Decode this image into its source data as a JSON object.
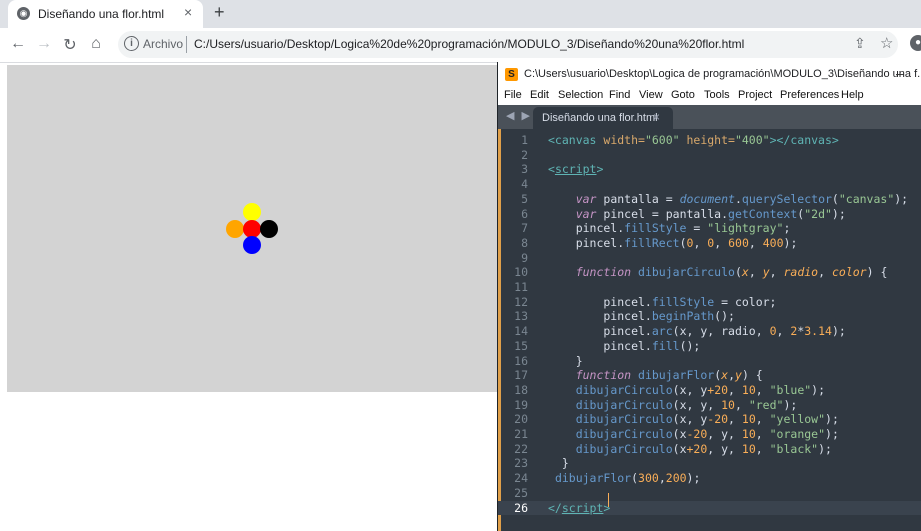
{
  "browser": {
    "tab_title": "Diseñando una flor.html",
    "tab_close": "×",
    "new_tab": "+",
    "back": "←",
    "forward": "→",
    "reload": "↻",
    "home": "⌂",
    "info": "i",
    "archivo_label": "Archivo",
    "url": "C:/Users/usuario/Desktop/Logica%20de%20programación/MODULO_3/Diseñando%20una%20flor.html",
    "share": "⇪",
    "star": "☆"
  },
  "flower": {
    "center": {
      "name": "red",
      "color": "#ff0000"
    },
    "top": {
      "name": "yellow",
      "color": "#ffff00"
    },
    "bottom": {
      "name": "blue",
      "color": "#0000ff"
    },
    "left": {
      "name": "orange",
      "color": "#ffa500"
    },
    "right": {
      "name": "black",
      "color": "#000000"
    },
    "background": "#d3d3d3"
  },
  "editor": {
    "title": "C:\\Users\\usuario\\Desktop\\Logica de programación\\MODULO_3\\Diseñando una f...",
    "minimize": "–",
    "menu": [
      "File",
      "Edit",
      "Selection",
      "Find",
      "View",
      "Goto",
      "Tools",
      "Project",
      "Preferences",
      "Help"
    ],
    "tab_arrows": "◀ ▶",
    "tab_label": "Diseñando una flor.html",
    "tab_close": "×",
    "accent": "#e0a04a",
    "background": "#303841",
    "current_line": 26,
    "lines": [
      [
        {
          "t": "<canvas ",
          "c": "tag"
        },
        {
          "t": "width=",
          "c": "attr"
        },
        {
          "t": "\"600\" ",
          "c": "str"
        },
        {
          "t": "height=",
          "c": "attr"
        },
        {
          "t": "\"400\"",
          "c": "str"
        },
        {
          "t": "></canvas>",
          "c": "tag"
        }
      ],
      [],
      [
        {
          "t": "<",
          "c": "tag"
        },
        {
          "t": "script",
          "c": "tag u"
        },
        {
          "t": ">",
          "c": "tag"
        }
      ],
      [],
      [
        {
          "t": "    "
        },
        {
          "t": "var ",
          "c": "kw"
        },
        {
          "t": "pantalla = "
        },
        {
          "t": "document",
          "c": "global"
        },
        {
          "t": "."
        },
        {
          "t": "querySelector",
          "c": "fn"
        },
        {
          "t": "("
        },
        {
          "t": "\"canvas\"",
          "c": "str"
        },
        {
          "t": ");"
        }
      ],
      [
        {
          "t": "    "
        },
        {
          "t": "var ",
          "c": "kw"
        },
        {
          "t": "pincel = pantalla."
        },
        {
          "t": "getContext",
          "c": "fn"
        },
        {
          "t": "("
        },
        {
          "t": "\"2d\"",
          "c": "str"
        },
        {
          "t": ");"
        }
      ],
      [
        {
          "t": "    pincel."
        },
        {
          "t": "fillStyle",
          "c": "fn"
        },
        {
          "t": " = "
        },
        {
          "t": "\"lightgray\"",
          "c": "str"
        },
        {
          "t": ";"
        }
      ],
      [
        {
          "t": "    pincel."
        },
        {
          "t": "fillRect",
          "c": "fn"
        },
        {
          "t": "("
        },
        {
          "t": "0",
          "c": "num"
        },
        {
          "t": ", "
        },
        {
          "t": "0",
          "c": "num"
        },
        {
          "t": ", "
        },
        {
          "t": "600",
          "c": "num"
        },
        {
          "t": ", "
        },
        {
          "t": "400",
          "c": "num"
        },
        {
          "t": ");"
        }
      ],
      [],
      [
        {
          "t": "    "
        },
        {
          "t": "function ",
          "c": "kw"
        },
        {
          "t": "dibujarCirculo",
          "c": "fnd"
        },
        {
          "t": "("
        },
        {
          "t": "x",
          "c": "param"
        },
        {
          "t": ", "
        },
        {
          "t": "y",
          "c": "param"
        },
        {
          "t": ", "
        },
        {
          "t": "radio",
          "c": "param"
        },
        {
          "t": ", "
        },
        {
          "t": "color",
          "c": "param"
        },
        {
          "t": ") {"
        }
      ],
      [],
      [
        {
          "t": "        pincel."
        },
        {
          "t": "fillStyle",
          "c": "fn"
        },
        {
          "t": " = color;"
        }
      ],
      [
        {
          "t": "        pincel."
        },
        {
          "t": "beginPath",
          "c": "fn"
        },
        {
          "t": "();"
        }
      ],
      [
        {
          "t": "        pincel."
        },
        {
          "t": "arc",
          "c": "fn"
        },
        {
          "t": "(x, y, radio, "
        },
        {
          "t": "0",
          "c": "num"
        },
        {
          "t": ", "
        },
        {
          "t": "2",
          "c": "num"
        },
        {
          "t": "*"
        },
        {
          "t": "3.14",
          "c": "num"
        },
        {
          "t": ");"
        }
      ],
      [
        {
          "t": "        pincel."
        },
        {
          "t": "fill",
          "c": "fn"
        },
        {
          "t": "();"
        }
      ],
      [
        {
          "t": "    }"
        }
      ],
      [
        {
          "t": "    "
        },
        {
          "t": "function ",
          "c": "kw"
        },
        {
          "t": "dibujarFlor",
          "c": "fnd"
        },
        {
          "t": "("
        },
        {
          "t": "x",
          "c": "param"
        },
        {
          "t": ","
        },
        {
          "t": "y",
          "c": "param"
        },
        {
          "t": ") {"
        }
      ],
      [
        {
          "t": "    "
        },
        {
          "t": "dibujarCirculo",
          "c": "fn"
        },
        {
          "t": "(x, y"
        },
        {
          "t": "+20",
          "c": "num"
        },
        {
          "t": ", "
        },
        {
          "t": "10",
          "c": "num"
        },
        {
          "t": ", "
        },
        {
          "t": "\"blue\"",
          "c": "str"
        },
        {
          "t": ");"
        }
      ],
      [
        {
          "t": "    "
        },
        {
          "t": "dibujarCirculo",
          "c": "fn"
        },
        {
          "t": "(x, y, "
        },
        {
          "t": "10",
          "c": "num"
        },
        {
          "t": ", "
        },
        {
          "t": "\"red\"",
          "c": "str"
        },
        {
          "t": ");"
        }
      ],
      [
        {
          "t": "    "
        },
        {
          "t": "dibujarCirculo",
          "c": "fn"
        },
        {
          "t": "(x, y"
        },
        {
          "t": "-20",
          "c": "num"
        },
        {
          "t": ", "
        },
        {
          "t": "10",
          "c": "num"
        },
        {
          "t": ", "
        },
        {
          "t": "\"yellow\"",
          "c": "str"
        },
        {
          "t": ");"
        }
      ],
      [
        {
          "t": "    "
        },
        {
          "t": "dibujarCirculo",
          "c": "fn"
        },
        {
          "t": "(x"
        },
        {
          "t": "-20",
          "c": "num"
        },
        {
          "t": ", y, "
        },
        {
          "t": "10",
          "c": "num"
        },
        {
          "t": ", "
        },
        {
          "t": "\"orange\"",
          "c": "str"
        },
        {
          "t": ");"
        }
      ],
      [
        {
          "t": "    "
        },
        {
          "t": "dibujarCirculo",
          "c": "fn"
        },
        {
          "t": "(x"
        },
        {
          "t": "+20",
          "c": "num"
        },
        {
          "t": ", y, "
        },
        {
          "t": "10",
          "c": "num"
        },
        {
          "t": ", "
        },
        {
          "t": "\"black\"",
          "c": "str"
        },
        {
          "t": ");"
        }
      ],
      [
        {
          "t": "  }"
        }
      ],
      [
        {
          "t": " "
        },
        {
          "t": "dibujarFlor",
          "c": "fn"
        },
        {
          "t": "("
        },
        {
          "t": "300",
          "c": "num"
        },
        {
          "t": ","
        },
        {
          "t": "200",
          "c": "num"
        },
        {
          "t": ");"
        }
      ],
      [],
      [
        {
          "t": "</",
          "c": "tag"
        },
        {
          "t": "script",
          "c": "tag u"
        },
        {
          "t": ">",
          "c": "tag"
        }
      ]
    ]
  }
}
